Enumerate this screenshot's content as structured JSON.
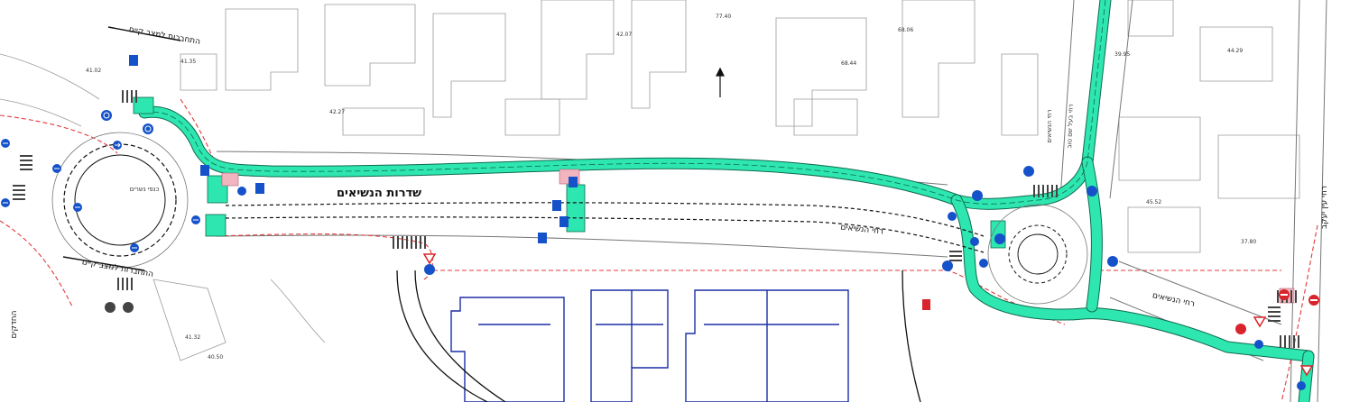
{
  "colors": {
    "bike_lane": "#2ee6b0",
    "bike_lane_border": "#0f6b4f",
    "sign_blue": "#1552c9",
    "sign_red": "#d8242b",
    "building_blue": "#1b2fa6",
    "boundary_red": "#e03a3a",
    "pink_patch": "#f2b5c0"
  },
  "labels": {
    "main_street": "שדרות הנשיאים",
    "south_street": "רחי הנשיאים",
    "south_street_right": "רחי הנשיאים",
    "north_connector_top": "התחברות למצב קיים",
    "north_connector_bottom": "התחברות למצב קיים",
    "hadkalim": "החדקים",
    "kanfei_nesharim": "כנפי נשרים",
    "street_n1": "רחי הנשיאים",
    "street_east": "רחי בעל שם טוב",
    "rehov_label": "רחי עין יעקב"
  },
  "elevations": [
    "41.02",
    "41.35",
    "42.07",
    "42.27",
    "77.40",
    "68.06",
    "68.44",
    "44.29",
    "39.95",
    "45.52",
    "37.80",
    "41.32",
    "40.50"
  ],
  "icons": [
    "no-entry-icon",
    "roundabout-icon",
    "direction-arrow-icon",
    "bike-icon",
    "yield-icon",
    "north-arrow-icon"
  ]
}
